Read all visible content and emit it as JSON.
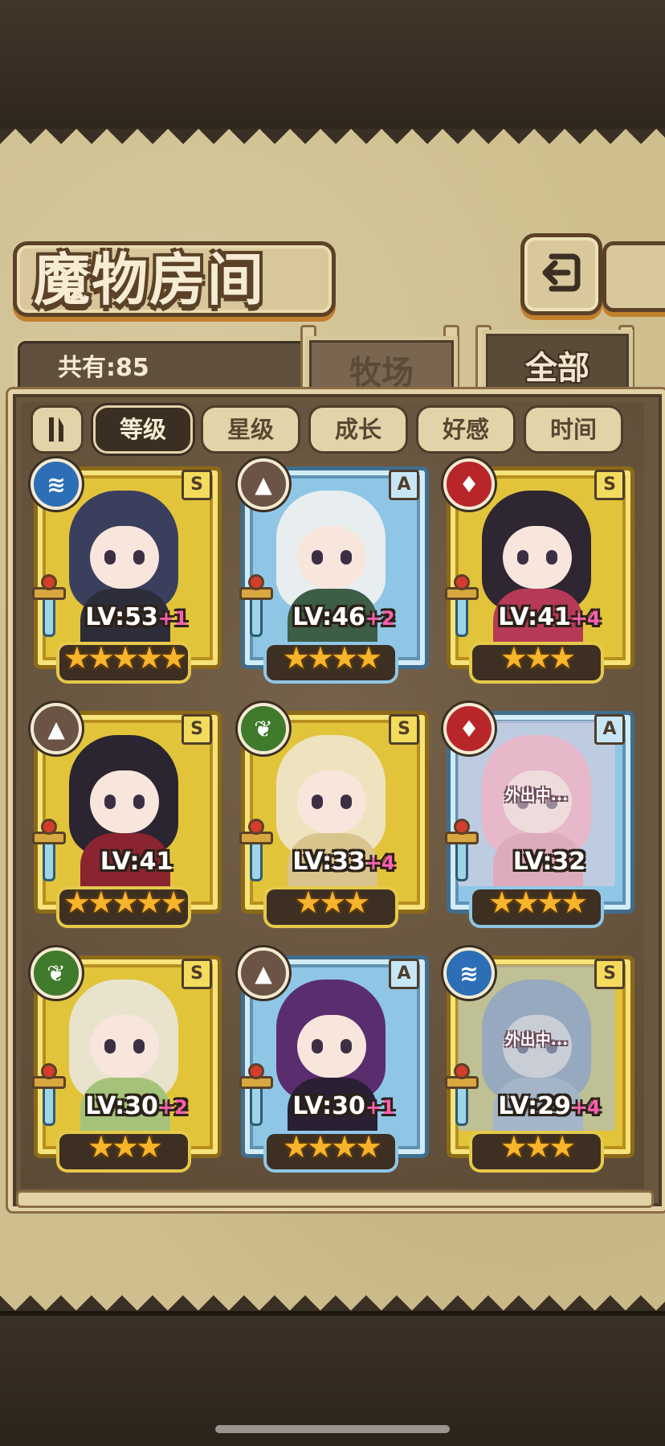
{
  "header": {
    "title": "魔物房间",
    "back_icon": "back-arrow-icon",
    "count_label": "共有:85"
  },
  "tabs": [
    {
      "label": "牧场",
      "active": false
    },
    {
      "label": "全部",
      "active": true
    }
  ],
  "filters": [
    {
      "label": "等级",
      "active": true
    },
    {
      "label": "星级",
      "active": false
    },
    {
      "label": "成长",
      "active": false
    },
    {
      "label": "好感",
      "active": false
    },
    {
      "label": "时间",
      "active": false
    }
  ],
  "sort_icon": "sort-order-icon",
  "monsters": [
    {
      "element": "water",
      "rank": "S",
      "frame": "gold",
      "lv": "LV:53",
      "plus": "+1",
      "stars": "★★★★★",
      "away": "",
      "hair": "#3b3f5e",
      "body": "#2d2d3a"
    },
    {
      "element": "earth",
      "rank": "A",
      "frame": "blue",
      "lv": "LV:46",
      "plus": "+2",
      "stars": "★★★★",
      "away": "",
      "hair": "#e8eef0",
      "body": "#3d5d46"
    },
    {
      "element": "fire",
      "rank": "S",
      "frame": "gold",
      "lv": "LV:41",
      "plus": "+4",
      "stars": "★★★",
      "away": "",
      "hair": "#2e2630",
      "body": "#b63a57"
    },
    {
      "element": "earth",
      "rank": "S",
      "frame": "gold",
      "lv": "LV:41",
      "plus": "",
      "stars": "★★★★★",
      "away": "",
      "hair": "#2a2530",
      "body": "#8a2430"
    },
    {
      "element": "wood",
      "rank": "S",
      "frame": "gold",
      "lv": "LV:33",
      "plus": "+4",
      "stars": "★★★",
      "away": "",
      "hair": "#efe2bf",
      "body": "#d8c48d"
    },
    {
      "element": "fire",
      "rank": "A",
      "frame": "blue",
      "lv": "LV:32",
      "plus": "",
      "stars": "★★★★",
      "away": "外出中...",
      "hair": "#e79ab2",
      "body": "#d47c98"
    },
    {
      "element": "wood",
      "rank": "S",
      "frame": "gold",
      "lv": "LV:30",
      "plus": "+2",
      "stars": "★★★",
      "away": "",
      "hair": "#e9e3cd",
      "body": "#a5c27a"
    },
    {
      "element": "earth",
      "rank": "A",
      "frame": "blue",
      "lv": "LV:30",
      "plus": "+1",
      "stars": "★★★★",
      "away": "",
      "hair": "#5a2d6e",
      "body": "#2b1f33"
    },
    {
      "element": "water",
      "rank": "S",
      "frame": "gold",
      "lv": "LV:29",
      "plus": "+4",
      "stars": "★★★",
      "away": "外出中...",
      "hair": "#7b8aa0",
      "body": "#9aa8b6"
    }
  ],
  "element_icons": {
    "water": "water-wave-icon",
    "earth": "mountain-icon",
    "fire": "flame-icon",
    "wood": "leaf-icon"
  },
  "colors": {
    "active_filter": "#3b2f23",
    "plus_level": "#ff5fb0",
    "star": "#f8b42a"
  }
}
